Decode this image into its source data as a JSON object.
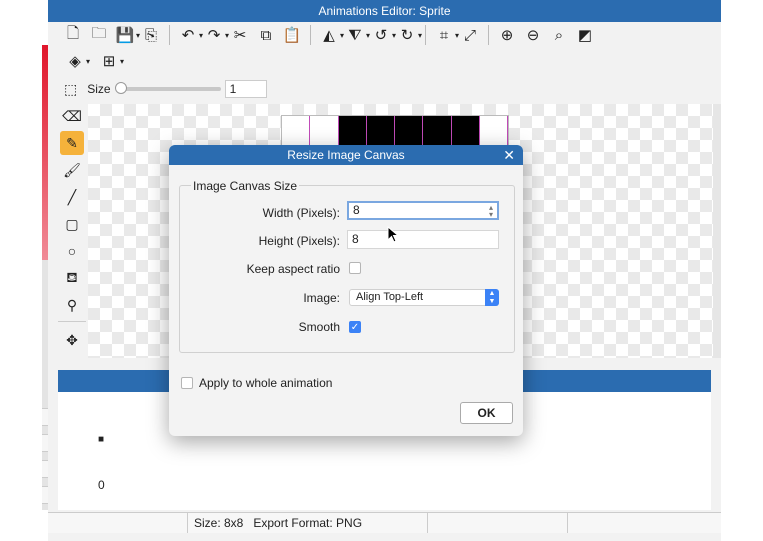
{
  "window": {
    "title": "Animations Editor: Sprite"
  },
  "toolbar": {
    "icons": [
      "new-file-icon",
      "open-folder-icon",
      "save-icon",
      "export-icon",
      "undo-icon",
      "redo-icon",
      "cut-icon",
      "copy-icon",
      "paste-icon",
      "flip-horizontal-icon",
      "flip-vertical-icon",
      "rotate-left-icon",
      "rotate-right-icon",
      "crop-icon",
      "resize-icon",
      "zoom-in-icon",
      "zoom-out-icon",
      "zoom-fit-icon",
      "fill-toggle-icon"
    ]
  },
  "tool_options": {
    "size_label": "Size",
    "size_value": "1",
    "size_slider_fraction": 0.0
  },
  "sprite_preview": {
    "pixels": [
      "white",
      "white",
      "black",
      "black",
      "black",
      "black",
      "black",
      "white"
    ]
  },
  "timeline": {
    "frame_glyph": "■",
    "frame_number": "0"
  },
  "statusbar": {
    "text": "Size: 8x8   Export Format: PNG"
  },
  "dialog": {
    "title": "Resize Image Canvas",
    "close_glyph": "✕",
    "group_title": "Image Canvas Size",
    "width_label": "Width (Pixels):",
    "width_value": "8",
    "height_label": "Height (Pixels):",
    "height_value": "8",
    "keep_aspect_label": "Keep aspect ratio",
    "keep_aspect_checked": false,
    "image_label": "Image:",
    "image_value": "Align Top-Left",
    "smooth_label": "Smooth",
    "smooth_checked": true,
    "apply_all_label": "Apply to whole animation",
    "apply_all_checked": false,
    "ok_label": "OK"
  },
  "colors": {
    "accent": "#2b6cb0",
    "checkbox_blue": "#3b82f6",
    "active_tool": "#f5b23b"
  }
}
